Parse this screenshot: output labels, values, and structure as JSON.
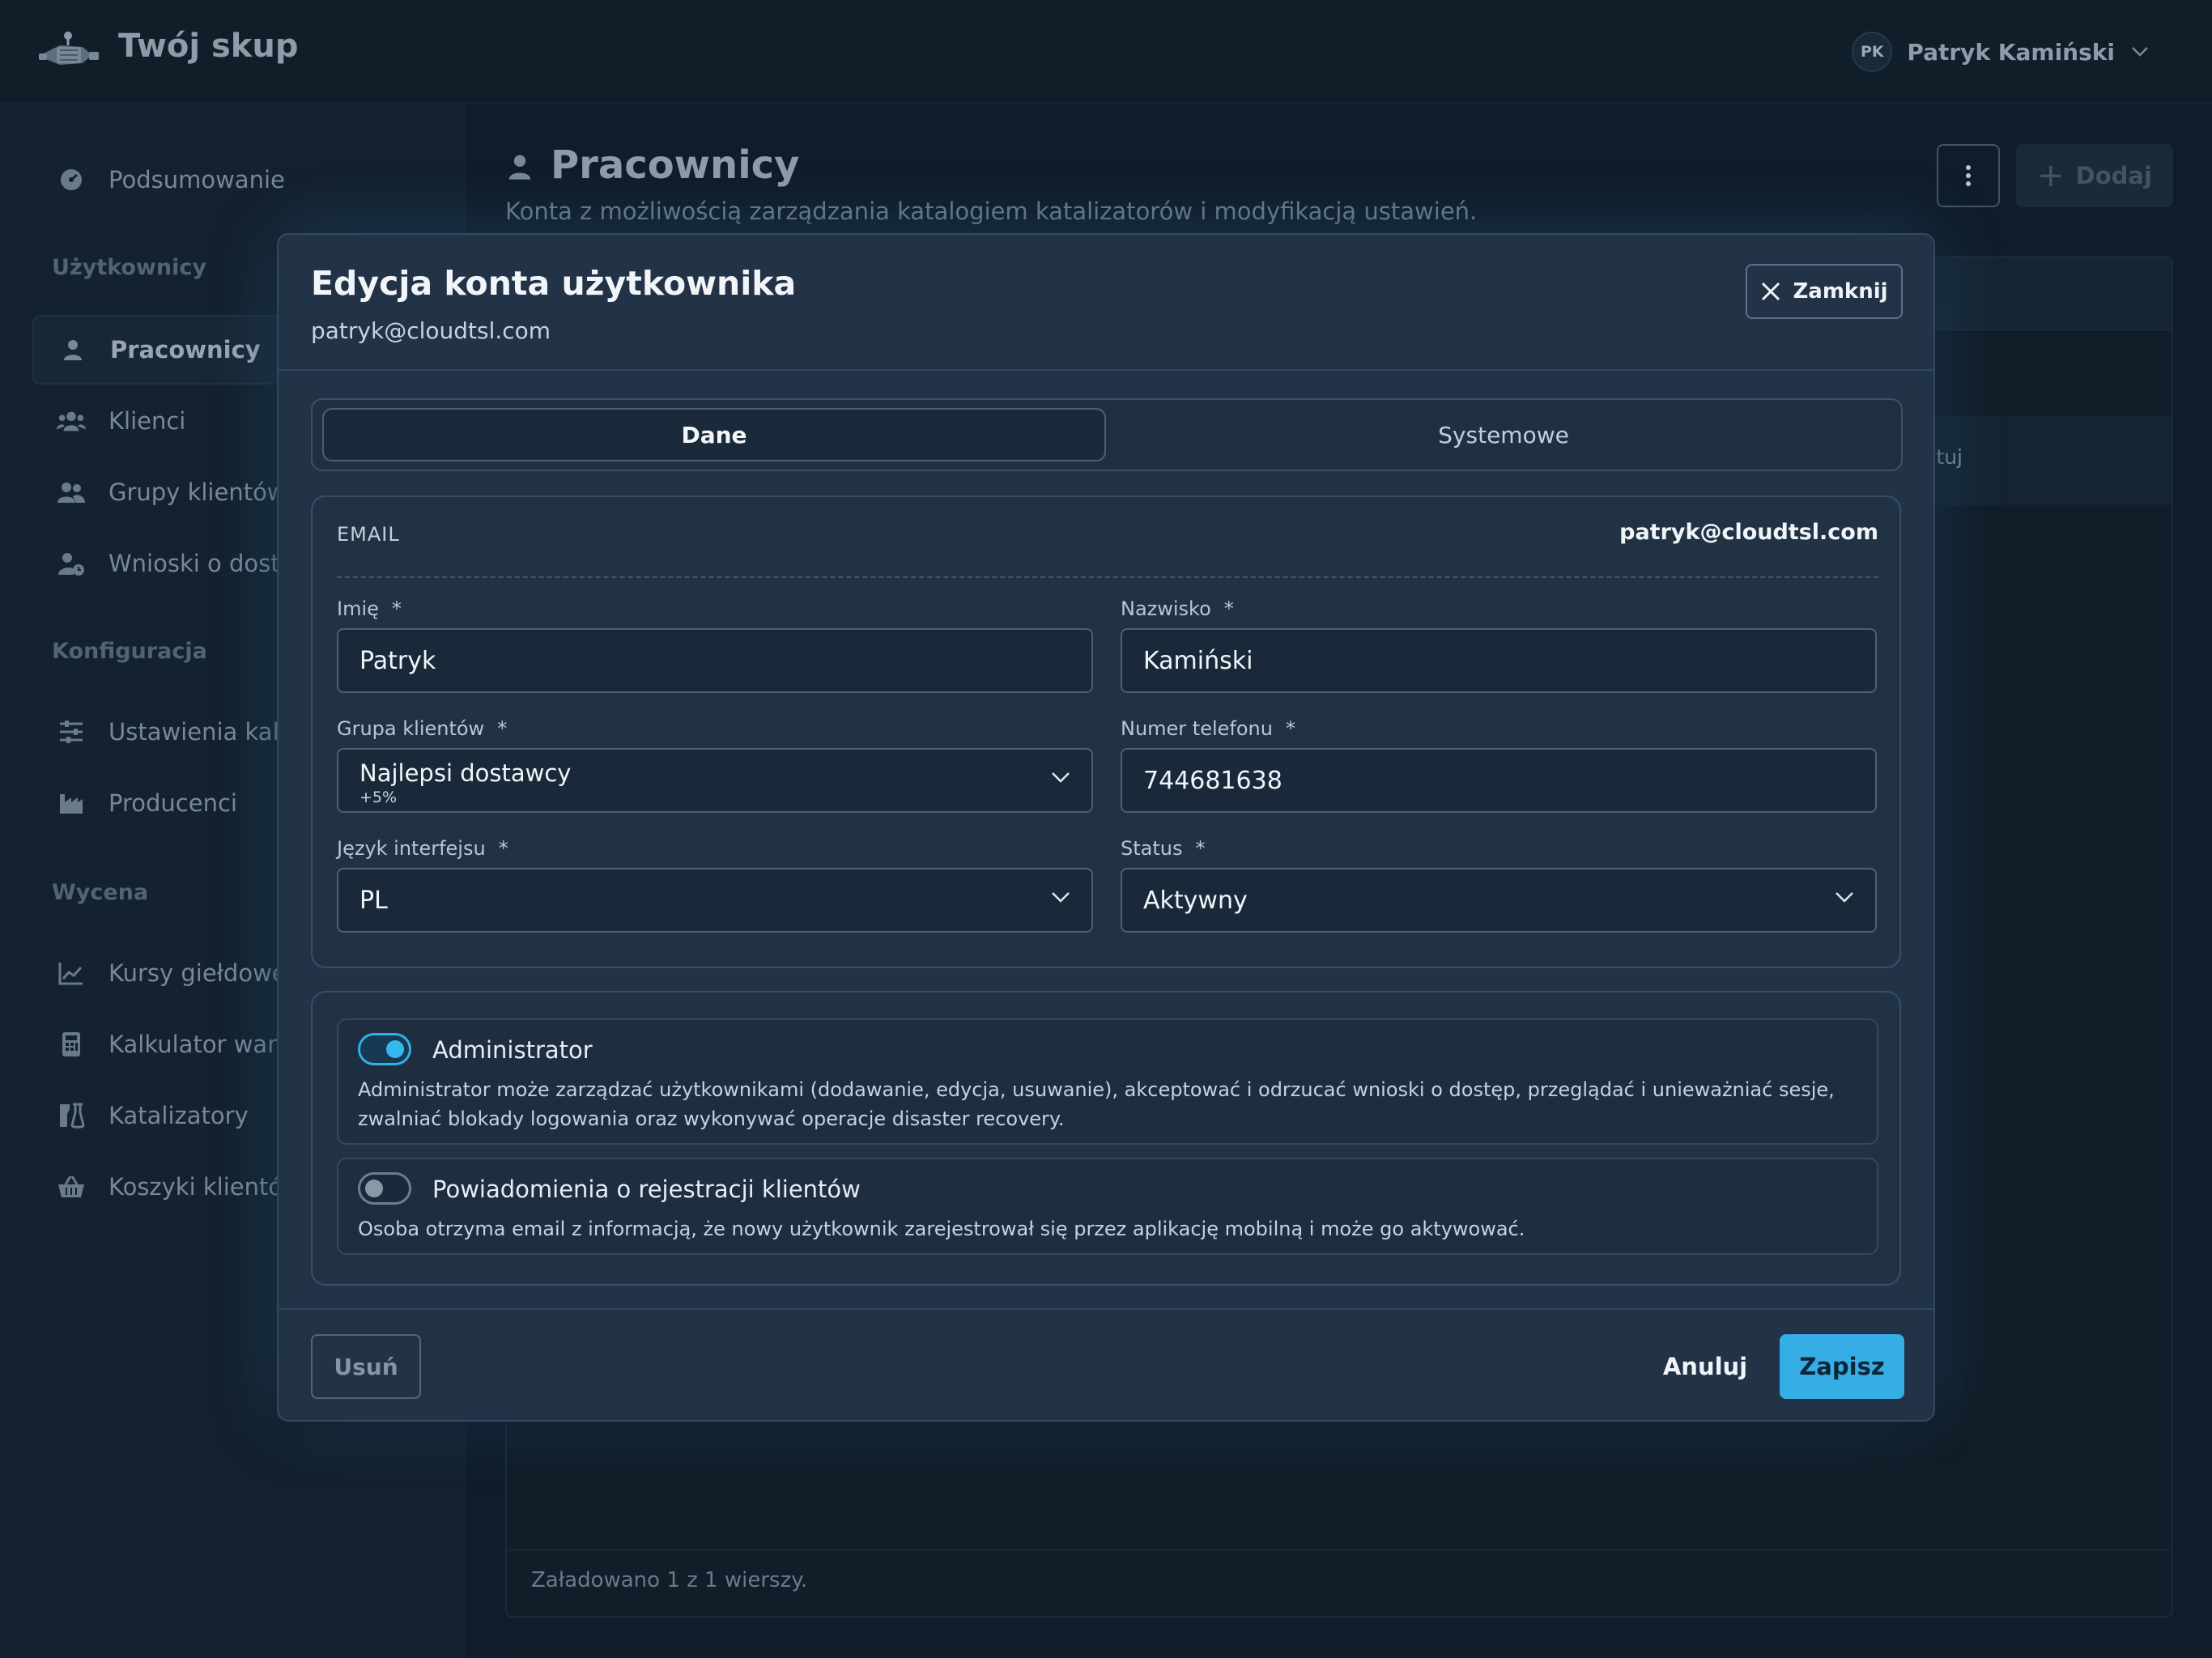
{
  "app": {
    "brand": "Twój skup"
  },
  "user": {
    "initials": "PK",
    "name": "Patryk Kamiński"
  },
  "sidebar": {
    "summary": "Podsumowanie",
    "sections": {
      "users": "Użytkownicy",
      "config": "Konfiguracja",
      "pricing": "Wycena"
    },
    "items": [
      {
        "label": "Pracownicy",
        "icon": "user-icon"
      },
      {
        "label": "Klienci",
        "icon": "users-group-icon"
      },
      {
        "label": "Grupy klientów",
        "icon": "user-group-icon"
      },
      {
        "label": "Wnioski o dostęp",
        "icon": "user-clock-icon"
      },
      {
        "label": "Ustawienia kalku",
        "icon": "sliders-icon"
      },
      {
        "label": "Producenci",
        "icon": "factory-icon"
      },
      {
        "label": "Kursy giełdowe",
        "icon": "chart-line-icon"
      },
      {
        "label": "Kalkulator wartoś",
        "icon": "calculator-icon"
      },
      {
        "label": "Katalizatory",
        "icon": "flask-icon"
      },
      {
        "label": "Koszyki klientów",
        "icon": "basket-icon"
      }
    ]
  },
  "page": {
    "title": "Pracownicy",
    "subtitle": "Konta z możliwością zarządzania katalogiem katalizatorów i modyfikacją ustawień.",
    "add_label": "Dodaj",
    "row_partial": "ytuj",
    "footer": "Załadowano 1 z 1 wierszy."
  },
  "modal": {
    "title": "Edycja konta użytkownika",
    "email": "patryk@cloudtsl.com",
    "close_label": "Zamknij",
    "tabs": [
      "Dane",
      "Systemowe"
    ],
    "email_label": "EMAIL",
    "email_value": "patryk@cloudtsl.com",
    "fields": {
      "first_name": {
        "label": "Imię",
        "value": "Patryk"
      },
      "last_name": {
        "label": "Nazwisko",
        "value": "Kamiński"
      },
      "group": {
        "label": "Grupa klientów",
        "value": "Najlepsi dostawcy",
        "sub": "+5%"
      },
      "phone": {
        "label": "Numer telefonu",
        "value": "744681638"
      },
      "language": {
        "label": "Język interfejsu",
        "value": "PL"
      },
      "status": {
        "label": "Status",
        "value": "Aktywny"
      }
    },
    "required_mark": "*",
    "options": [
      {
        "title": "Administrator",
        "enabled": true,
        "description": "Administrator może zarządzać użytkownikami (dodawanie, edycja, usuwanie), akceptować i odrzucać wnioski o dostęp, przeglądać i unieważniać sesje, zwalniać blokady logowania oraz wykonywać operacje disaster recovery."
      },
      {
        "title": "Powiadomienia o rejestracji klientów",
        "enabled": false,
        "description": "Osoba otrzyma email z informacją, że nowy użytkownik zarejestrował się przez aplikację mobilną i może go aktywować."
      }
    ],
    "delete_label": "Usuń",
    "cancel_label": "Anuluj",
    "save_label": "Zapisz"
  },
  "colors": {
    "accent": "#35ade5",
    "background": "#12202e",
    "modal": "#223347"
  }
}
